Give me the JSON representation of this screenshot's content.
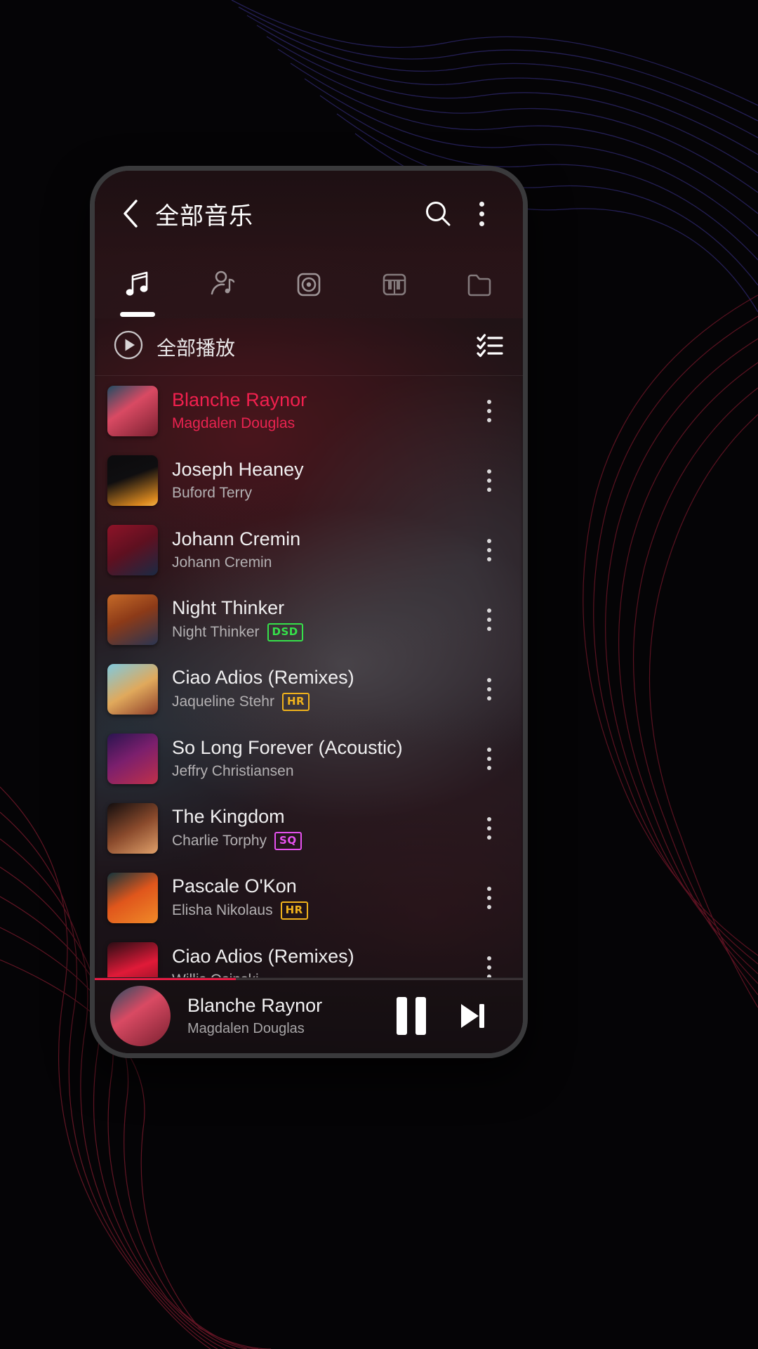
{
  "appbar": {
    "title": "全部音乐",
    "back_icon": "chevron-left-icon",
    "search_icon": "search-icon",
    "overflow_icon": "more-vertical-icon"
  },
  "tabs": [
    {
      "name": "songs",
      "icon": "music-note-icon",
      "active": true
    },
    {
      "name": "artists",
      "icon": "artist-icon",
      "active": false
    },
    {
      "name": "albums",
      "icon": "album-disc-icon",
      "active": false
    },
    {
      "name": "genres",
      "icon": "piano-keys-icon",
      "active": false
    },
    {
      "name": "folders",
      "icon": "folder-icon",
      "active": false
    }
  ],
  "playall": {
    "label": "全部播放",
    "play_icon": "play-circle-icon",
    "multiselect_icon": "checklist-icon"
  },
  "songs": [
    {
      "title": "Blanche Raynor",
      "artist": "Magdalen Douglas",
      "badge": "",
      "playing": true,
      "art": "linear-gradient(145deg,#1f4d63 0%,#d94a63 42%,#7a2030 100%)"
    },
    {
      "title": "Joseph Heaney",
      "artist": "Buford Terry",
      "badge": "",
      "playing": false,
      "art": "linear-gradient(160deg,#0b0b0d 0%,#0f0e10 42%,#d9881f 88%,#f2b24a 100%)"
    },
    {
      "title": "Johann Cremin",
      "artist": "Johann Cremin",
      "badge": "",
      "playing": false,
      "art": "linear-gradient(150deg,#8e1328 0%,#5e1020 48%,#1a2a44 100%)"
    },
    {
      "title": "Night Thinker",
      "artist": "Night Thinker",
      "badge": "DSD",
      "playing": false,
      "art": "linear-gradient(155deg,#c56a28 0%,#8c3a18 46%,#2a3552 100%)"
    },
    {
      "title": "Ciao Adios (Remixes)",
      "artist": "Jaqueline Stehr",
      "badge": "HR",
      "playing": false,
      "art": "linear-gradient(150deg,#7fc9de 0%,#e0a95c 52%,#8e3f2a 100%)"
    },
    {
      "title": "So Long Forever (Acoustic)",
      "artist": "Jeffry Christiansen",
      "badge": "",
      "playing": false,
      "art": "linear-gradient(150deg,#2a1450 0%,#7b1f6d 46%,#c0304a 100%)"
    },
    {
      "title": "The Kingdom",
      "artist": "Charlie Torphy",
      "badge": "SQ",
      "playing": false,
      "art": "linear-gradient(150deg,#120d0e 0%,#8a4a2c 52%,#e0a06a 100%)"
    },
    {
      "title": "Pascale O'Kon",
      "artist": "Elisha Nikolaus",
      "badge": "HR",
      "playing": false,
      "art": "linear-gradient(150deg,#13343c 0%,#e0561c 48%,#f08a28 100%)"
    },
    {
      "title": "Ciao Adios (Remixes)",
      "artist": "Willis Osinski",
      "badge": "",
      "playing": false,
      "art": "linear-gradient(160deg,#2a0d14 0%,#e01a38 52%,#7a0f20 100%)"
    }
  ],
  "nowplaying": {
    "title": "Blanche Raynor",
    "artist": "Magdalen Douglas",
    "progress_percent": 33,
    "pause_icon": "pause-icon",
    "next_icon": "skip-next-icon",
    "art": "linear-gradient(145deg,#1f4d63 0%,#d94a63 42%,#7a2030 100%)"
  },
  "colors": {
    "accent": "#e31b43",
    "playing_text": "#f1204e",
    "badge_dsd": "#36e04a",
    "badge_hr": "#f0b21c",
    "badge_sq": "#e651ef"
  }
}
